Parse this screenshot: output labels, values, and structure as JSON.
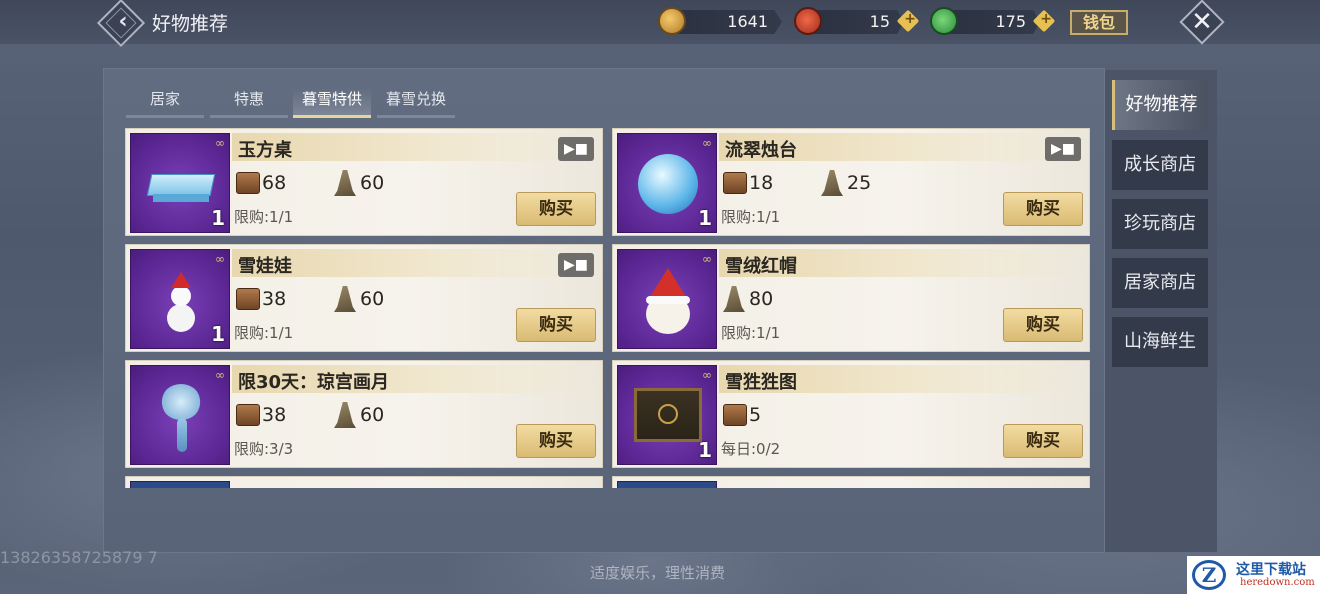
{
  "header": {
    "title": "好物推荐",
    "currencies": [
      {
        "icon": "gold-coin-icon",
        "value": "1641"
      },
      {
        "icon": "red-jade-icon",
        "value": "15"
      },
      {
        "icon": "green-jade-icon",
        "value": "175"
      }
    ],
    "wallet_label": "钱包"
  },
  "tabs": [
    {
      "label": "居家"
    },
    {
      "label": "特惠"
    },
    {
      "label": "暮雪特供",
      "active": true
    },
    {
      "label": "暮雪兑换"
    }
  ],
  "items": [
    {
      "name": "玉方桌",
      "qty": "1",
      "has_video": true,
      "price1": "68",
      "price2": "60",
      "limit": "限购:1/1",
      "buy": "购买"
    },
    {
      "name": "流翠烛台",
      "qty": "1",
      "has_video": true,
      "price1": "18",
      "price2": "25",
      "limit": "限购:1/1",
      "buy": "购买"
    },
    {
      "name": "雪娃娃",
      "qty": "1",
      "has_video": true,
      "price1": "38",
      "price2": "60",
      "limit": "限购:1/1",
      "buy": "购买"
    },
    {
      "name": "雪绒红帽",
      "qty": "",
      "has_video": false,
      "price1": "",
      "price2": "80",
      "limit": "限购:1/1",
      "buy": "购买"
    },
    {
      "name": "限30天：琼宫画月",
      "qty": "",
      "has_video": false,
      "price1": "38",
      "price2": "60",
      "limit": "限购:3/3",
      "buy": "购买"
    },
    {
      "name": "雪狌狌图",
      "qty": "1",
      "has_video": false,
      "price1": "5",
      "price2": "",
      "limit": "每日:0/2",
      "buy": "购买"
    }
  ],
  "side_tabs": [
    {
      "label": "好物推荐",
      "active": true
    },
    {
      "label": "成长商店"
    },
    {
      "label": "珍玩商店"
    },
    {
      "label": "居家商店"
    },
    {
      "label": "山海鲜生"
    }
  ],
  "footer": {
    "note": "适度娱乐，理性消费",
    "user_id": "13826358725879 7"
  },
  "watermark": {
    "line1": "这里下载站",
    "line2": "heredown.com",
    "logo": "Z"
  },
  "colors": {
    "accent_gold": "#d9ba72",
    "card_bg": "#f3efe6",
    "thumb_purple": "#5a2692",
    "panel": "#5e687c"
  }
}
